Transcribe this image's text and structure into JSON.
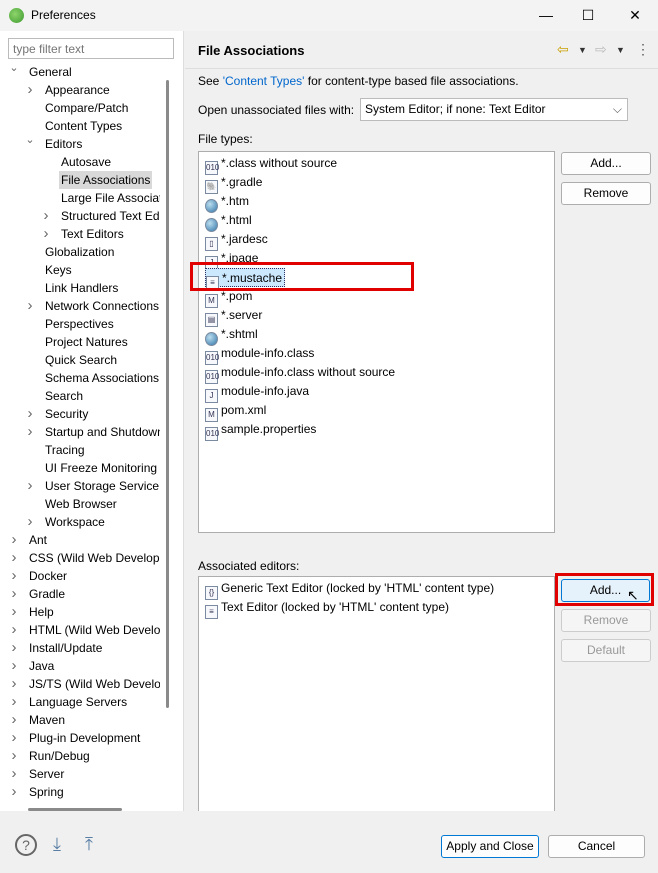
{
  "window": {
    "title": "Preferences",
    "minimize": "—",
    "maximize": "☐",
    "close": "✕"
  },
  "sidebar": {
    "filter_placeholder": "type filter text",
    "items": [
      {
        "label": "General",
        "level": 0,
        "arrow": "open"
      },
      {
        "label": "Appearance",
        "level": 1,
        "arrow": "closed"
      },
      {
        "label": "Compare/Patch",
        "level": 1
      },
      {
        "label": "Content Types",
        "level": 1
      },
      {
        "label": "Editors",
        "level": 1,
        "arrow": "open"
      },
      {
        "label": "Autosave",
        "level": 2
      },
      {
        "label": "File Associations",
        "level": 2,
        "selected": true
      },
      {
        "label": "Large File Associations",
        "level": 2
      },
      {
        "label": "Structured Text Editors",
        "level": 2,
        "arrow": "closed"
      },
      {
        "label": "Text Editors",
        "level": 2,
        "arrow": "closed"
      },
      {
        "label": "Globalization",
        "level": 1
      },
      {
        "label": "Keys",
        "level": 1
      },
      {
        "label": "Link Handlers",
        "level": 1
      },
      {
        "label": "Network Connections",
        "level": 1,
        "arrow": "closed"
      },
      {
        "label": "Perspectives",
        "level": 1
      },
      {
        "label": "Project Natures",
        "level": 1
      },
      {
        "label": "Quick Search",
        "level": 1
      },
      {
        "label": "Schema Associations",
        "level": 1
      },
      {
        "label": "Search",
        "level": 1
      },
      {
        "label": "Security",
        "level": 1,
        "arrow": "closed"
      },
      {
        "label": "Startup and Shutdown",
        "level": 1,
        "arrow": "closed"
      },
      {
        "label": "Tracing",
        "level": 1
      },
      {
        "label": "UI Freeze Monitoring",
        "level": 1
      },
      {
        "label": "User Storage Service",
        "level": 1,
        "arrow": "closed"
      },
      {
        "label": "Web Browser",
        "level": 1
      },
      {
        "label": "Workspace",
        "level": 1,
        "arrow": "closed"
      },
      {
        "label": "Ant",
        "level": 0,
        "arrow": "closed"
      },
      {
        "label": "CSS (Wild Web Developer)",
        "level": 0,
        "arrow": "closed"
      },
      {
        "label": "Docker",
        "level": 0,
        "arrow": "closed"
      },
      {
        "label": "Gradle",
        "level": 0,
        "arrow": "closed"
      },
      {
        "label": "Help",
        "level": 0,
        "arrow": "closed"
      },
      {
        "label": "HTML (Wild Web Developer)",
        "level": 0,
        "arrow": "closed"
      },
      {
        "label": "Install/Update",
        "level": 0,
        "arrow": "closed"
      },
      {
        "label": "Java",
        "level": 0,
        "arrow": "closed"
      },
      {
        "label": "JS/TS (Wild Web Developer)",
        "level": 0,
        "arrow": "closed"
      },
      {
        "label": "Language Servers",
        "level": 0,
        "arrow": "closed"
      },
      {
        "label": "Maven",
        "level": 0,
        "arrow": "closed"
      },
      {
        "label": "Plug-in Development",
        "level": 0,
        "arrow": "closed"
      },
      {
        "label": "Run/Debug",
        "level": 0,
        "arrow": "closed"
      },
      {
        "label": "Server",
        "level": 0,
        "arrow": "closed"
      },
      {
        "label": "Spring",
        "level": 0,
        "arrow": "closed"
      }
    ]
  },
  "page": {
    "title": "File Associations",
    "see_prefix": "See ",
    "see_link": "'Content Types'",
    "see_suffix": " for content-type based file associations.",
    "open_label": "Open unassociated files with:",
    "open_value": "System Editor; if none: Text Editor",
    "file_types_label": "File types:",
    "file_types": [
      {
        "label": "*.class without source",
        "icon": "class-file-icon",
        "glyph": "010"
      },
      {
        "label": "*.gradle",
        "icon": "gradle-elephant-icon",
        "glyph": "🐘"
      },
      {
        "label": "*.htm",
        "icon": "globe-icon",
        "glyph": "●"
      },
      {
        "label": "*.html",
        "icon": "globe-icon",
        "glyph": "●"
      },
      {
        "label": "*.jardesc",
        "icon": "jar-icon",
        "glyph": "▯"
      },
      {
        "label": "*.jpage",
        "icon": "java-file-icon",
        "glyph": "J"
      },
      {
        "label": "*.mustache",
        "icon": "text-file-icon",
        "glyph": "≡",
        "selected": true
      },
      {
        "label": "*.pom",
        "icon": "maven-file-icon",
        "glyph": "M"
      },
      {
        "label": "*.server",
        "icon": "server-icon",
        "glyph": "▤"
      },
      {
        "label": "*.shtml",
        "icon": "globe-icon",
        "glyph": "●"
      },
      {
        "label": "module-info.class",
        "icon": "class-file-icon",
        "glyph": "010"
      },
      {
        "label": "module-info.class without source",
        "icon": "class-file-icon",
        "glyph": "010"
      },
      {
        "label": "module-info.java",
        "icon": "java-file-icon",
        "glyph": "J"
      },
      {
        "label": "pom.xml",
        "icon": "maven-file-icon",
        "glyph": "M"
      },
      {
        "label": "sample.properties",
        "icon": "properties-file-icon",
        "glyph": "010"
      }
    ],
    "add_label": "Add...",
    "remove_label": "Remove",
    "editors_label": "Associated editors:",
    "editors": [
      {
        "label": "Generic Text Editor (locked by 'HTML' content type)",
        "icon": "generic-editor-icon",
        "glyph": "{}"
      },
      {
        "label": "Text Editor (locked by 'HTML' content type)",
        "icon": "text-file-icon",
        "glyph": "≡"
      }
    ],
    "editor_add_label": "Add...",
    "editor_remove_label": "Remove",
    "default_label": "Default"
  },
  "footer": {
    "apply_close": "Apply and Close",
    "cancel": "Cancel"
  },
  "colors": {
    "highlight": "#e00000",
    "link": "#0066cc",
    "selection": "#cce8ff"
  }
}
